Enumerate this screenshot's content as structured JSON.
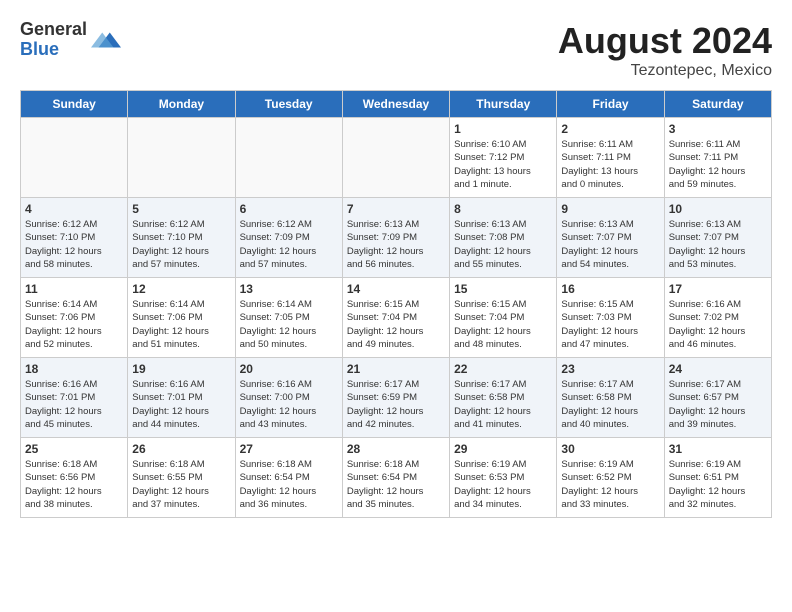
{
  "header": {
    "logo_general": "General",
    "logo_blue": "Blue",
    "month_year": "August 2024",
    "location": "Tezontepec, Mexico"
  },
  "days_of_week": [
    "Sunday",
    "Monday",
    "Tuesday",
    "Wednesday",
    "Thursday",
    "Friday",
    "Saturday"
  ],
  "weeks": [
    [
      {
        "day": "",
        "info": ""
      },
      {
        "day": "",
        "info": ""
      },
      {
        "day": "",
        "info": ""
      },
      {
        "day": "",
        "info": ""
      },
      {
        "day": "1",
        "info": "Sunrise: 6:10 AM\nSunset: 7:12 PM\nDaylight: 13 hours\nand 1 minute."
      },
      {
        "day": "2",
        "info": "Sunrise: 6:11 AM\nSunset: 7:11 PM\nDaylight: 13 hours\nand 0 minutes."
      },
      {
        "day": "3",
        "info": "Sunrise: 6:11 AM\nSunset: 7:11 PM\nDaylight: 12 hours\nand 59 minutes."
      }
    ],
    [
      {
        "day": "4",
        "info": "Sunrise: 6:12 AM\nSunset: 7:10 PM\nDaylight: 12 hours\nand 58 minutes."
      },
      {
        "day": "5",
        "info": "Sunrise: 6:12 AM\nSunset: 7:10 PM\nDaylight: 12 hours\nand 57 minutes."
      },
      {
        "day": "6",
        "info": "Sunrise: 6:12 AM\nSunset: 7:09 PM\nDaylight: 12 hours\nand 57 minutes."
      },
      {
        "day": "7",
        "info": "Sunrise: 6:13 AM\nSunset: 7:09 PM\nDaylight: 12 hours\nand 56 minutes."
      },
      {
        "day": "8",
        "info": "Sunrise: 6:13 AM\nSunset: 7:08 PM\nDaylight: 12 hours\nand 55 minutes."
      },
      {
        "day": "9",
        "info": "Sunrise: 6:13 AM\nSunset: 7:07 PM\nDaylight: 12 hours\nand 54 minutes."
      },
      {
        "day": "10",
        "info": "Sunrise: 6:13 AM\nSunset: 7:07 PM\nDaylight: 12 hours\nand 53 minutes."
      }
    ],
    [
      {
        "day": "11",
        "info": "Sunrise: 6:14 AM\nSunset: 7:06 PM\nDaylight: 12 hours\nand 52 minutes."
      },
      {
        "day": "12",
        "info": "Sunrise: 6:14 AM\nSunset: 7:06 PM\nDaylight: 12 hours\nand 51 minutes."
      },
      {
        "day": "13",
        "info": "Sunrise: 6:14 AM\nSunset: 7:05 PM\nDaylight: 12 hours\nand 50 minutes."
      },
      {
        "day": "14",
        "info": "Sunrise: 6:15 AM\nSunset: 7:04 PM\nDaylight: 12 hours\nand 49 minutes."
      },
      {
        "day": "15",
        "info": "Sunrise: 6:15 AM\nSunset: 7:04 PM\nDaylight: 12 hours\nand 48 minutes."
      },
      {
        "day": "16",
        "info": "Sunrise: 6:15 AM\nSunset: 7:03 PM\nDaylight: 12 hours\nand 47 minutes."
      },
      {
        "day": "17",
        "info": "Sunrise: 6:16 AM\nSunset: 7:02 PM\nDaylight: 12 hours\nand 46 minutes."
      }
    ],
    [
      {
        "day": "18",
        "info": "Sunrise: 6:16 AM\nSunset: 7:01 PM\nDaylight: 12 hours\nand 45 minutes."
      },
      {
        "day": "19",
        "info": "Sunrise: 6:16 AM\nSunset: 7:01 PM\nDaylight: 12 hours\nand 44 minutes."
      },
      {
        "day": "20",
        "info": "Sunrise: 6:16 AM\nSunset: 7:00 PM\nDaylight: 12 hours\nand 43 minutes."
      },
      {
        "day": "21",
        "info": "Sunrise: 6:17 AM\nSunset: 6:59 PM\nDaylight: 12 hours\nand 42 minutes."
      },
      {
        "day": "22",
        "info": "Sunrise: 6:17 AM\nSunset: 6:58 PM\nDaylight: 12 hours\nand 41 minutes."
      },
      {
        "day": "23",
        "info": "Sunrise: 6:17 AM\nSunset: 6:58 PM\nDaylight: 12 hours\nand 40 minutes."
      },
      {
        "day": "24",
        "info": "Sunrise: 6:17 AM\nSunset: 6:57 PM\nDaylight: 12 hours\nand 39 minutes."
      }
    ],
    [
      {
        "day": "25",
        "info": "Sunrise: 6:18 AM\nSunset: 6:56 PM\nDaylight: 12 hours\nand 38 minutes."
      },
      {
        "day": "26",
        "info": "Sunrise: 6:18 AM\nSunset: 6:55 PM\nDaylight: 12 hours\nand 37 minutes."
      },
      {
        "day": "27",
        "info": "Sunrise: 6:18 AM\nSunset: 6:54 PM\nDaylight: 12 hours\nand 36 minutes."
      },
      {
        "day": "28",
        "info": "Sunrise: 6:18 AM\nSunset: 6:54 PM\nDaylight: 12 hours\nand 35 minutes."
      },
      {
        "day": "29",
        "info": "Sunrise: 6:19 AM\nSunset: 6:53 PM\nDaylight: 12 hours\nand 34 minutes."
      },
      {
        "day": "30",
        "info": "Sunrise: 6:19 AM\nSunset: 6:52 PM\nDaylight: 12 hours\nand 33 minutes."
      },
      {
        "day": "31",
        "info": "Sunrise: 6:19 AM\nSunset: 6:51 PM\nDaylight: 12 hours\nand 32 minutes."
      }
    ]
  ]
}
